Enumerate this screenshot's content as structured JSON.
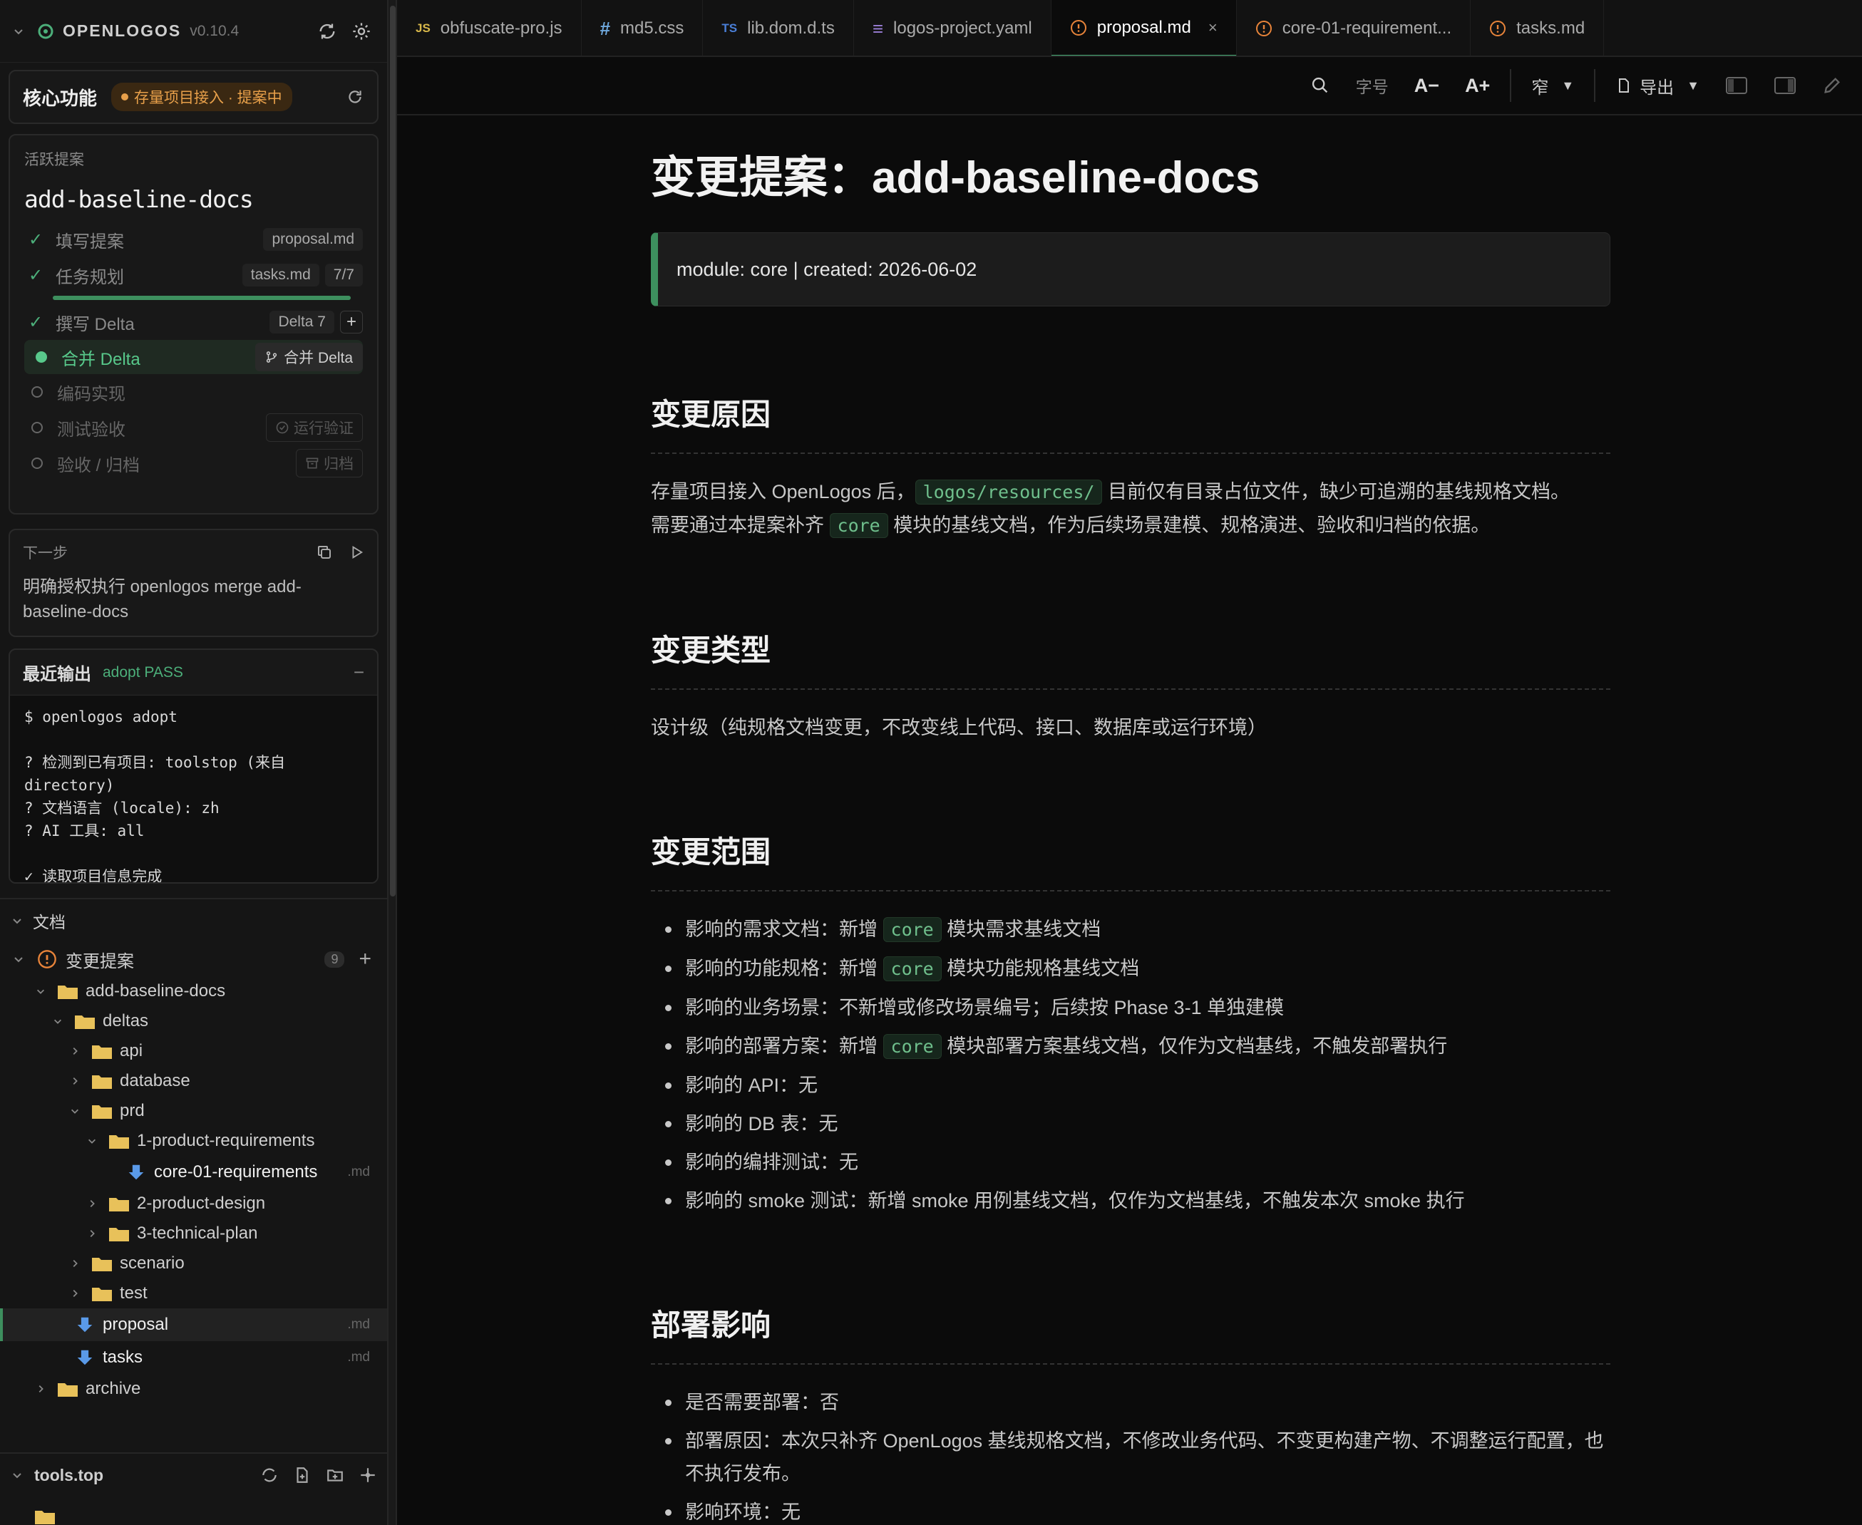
{
  "app": {
    "name": "OPENLOGOS",
    "version": "v0.10.4"
  },
  "core": {
    "title": "核心功能",
    "badge": "存量项目接入 · 提案中"
  },
  "proposal": {
    "section_label": "活跃提案",
    "name": "add-baseline-docs",
    "steps": [
      {
        "label": "填写提案",
        "pill": "proposal.md",
        "done": true
      },
      {
        "label": "任务规划",
        "pill": "tasks.md",
        "pill2": "7/7",
        "done": true
      },
      {
        "label": "撰写 Delta",
        "pill": "Delta 7",
        "done": true
      },
      {
        "label": "合并 Delta",
        "action": "合并 Delta",
        "active": true
      },
      {
        "label": "编码实现"
      },
      {
        "label": "测试验收",
        "action": "运行验证"
      },
      {
        "label": "验收 / 归档",
        "action": "归档"
      }
    ],
    "task_progress": 1.0
  },
  "next": {
    "label": "下一步",
    "text": "明确授权执行 openlogos merge add-baseline-docs"
  },
  "output": {
    "title": "最近输出",
    "status": "adopt PASS",
    "lines": "$ openlogos adopt\n\n? 检测到已有项目: toolstop (来自 directory)\n? 文档语言 (locale): zh\n? AI 工具: all\n\n✓ 读取项目信息完成"
  },
  "docs": {
    "section": "文档",
    "group": "变更提案",
    "group_count": "9",
    "tree": [
      {
        "name": "add-baseline-docs",
        "depth": 1,
        "type": "folder",
        "open": true
      },
      {
        "name": "deltas",
        "depth": 2,
        "type": "folder",
        "open": true
      },
      {
        "name": "api",
        "depth": 3,
        "type": "folder"
      },
      {
        "name": "database",
        "depth": 3,
        "type": "folder"
      },
      {
        "name": "prd",
        "depth": 3,
        "type": "folder",
        "open": true
      },
      {
        "name": "1-product-requirements",
        "depth": 4,
        "type": "folder",
        "open": true
      },
      {
        "name": "core-01-requirements",
        "depth": 5,
        "type": "file",
        "ext": ".md"
      },
      {
        "name": "2-product-design",
        "depth": 4,
        "type": "folder"
      },
      {
        "name": "3-technical-plan",
        "depth": 4,
        "type": "folder"
      },
      {
        "name": "scenario",
        "depth": 3,
        "type": "folder"
      },
      {
        "name": "test",
        "depth": 3,
        "type": "folder"
      },
      {
        "name": "proposal",
        "depth": 2,
        "type": "file",
        "ext": ".md",
        "selected": true
      },
      {
        "name": "tasks",
        "depth": 2,
        "type": "file",
        "ext": ".md"
      },
      {
        "name": "archive",
        "depth": 1,
        "type": "folder"
      }
    ]
  },
  "workspace": {
    "name": "tools.top"
  },
  "tabs": [
    {
      "label": "obfuscate-pro.js",
      "icon": "JS",
      "color": "#d8b84a"
    },
    {
      "label": "md5.css",
      "icon": "#",
      "color": "#6fa8dc"
    },
    {
      "label": "lib.dom.d.ts",
      "icon": "TS",
      "color": "#4a7fd8"
    },
    {
      "label": "logos-project.yaml",
      "icon": "≡",
      "color": "#9b7fd8"
    },
    {
      "label": "proposal.md",
      "icon": "!",
      "color": "#e8843a",
      "active": true
    },
    {
      "label": "core-01-requirement...",
      "icon": "!",
      "color": "#e8843a"
    },
    {
      "label": "tasks.md",
      "icon": "!",
      "color": "#e8843a"
    }
  ],
  "toolbar": {
    "font_label": "字号",
    "dec": "A−",
    "inc": "A+",
    "width": "窄",
    "export": "导出"
  },
  "doc": {
    "title": "变更提案：add-baseline-docs",
    "meta": "module: core | created: 2026-06-02",
    "s1": {
      "h": "变更原因",
      "p1a": "存量项目接入 OpenLogos 后，",
      "c1": "logos/resources/",
      "p1b": " 目前仅有目录占位文件，缺少可追溯的基线规格文档。",
      "p2a": "需要通过本提案补齐 ",
      "c2": "core",
      "p2b": " 模块的基线文档，作为后续场景建模、规格演进、验收和归档的依据。"
    },
    "s2": {
      "h": "变更类型",
      "p": "设计级（纯规格文档变更，不改变线上代码、接口、数据库或运行环境）"
    },
    "s3": {
      "h": "变更范围",
      "items": [
        {
          "a": "影响的需求文档：新增 ",
          "code": "core",
          "b": " 模块需求基线文档"
        },
        {
          "a": "影响的功能规格：新增 ",
          "code": "core",
          "b": " 模块功能规格基线文档"
        },
        {
          "a": "影响的业务场景：不新增或修改场景编号；后续按 Phase 3-1 单独建模"
        },
        {
          "a": "影响的部署方案：新增 ",
          "code": "core",
          "b": " 模块部署方案基线文档，仅作为文档基线，不触发部署执行"
        },
        {
          "a": "影响的 API：无"
        },
        {
          "a": "影响的 DB 表：无"
        },
        {
          "a": "影响的编排测试：无"
        },
        {
          "a": "影响的 smoke 测试：新增 smoke 用例基线文档，仅作为文档基线，不触发本次 smoke 执行"
        }
      ]
    },
    "s4": {
      "h": "部署影响",
      "items": [
        {
          "a": "是否需要部署：否"
        },
        {
          "a": "部署原因：本次只补齐 OpenLogos 基线规格文档，不修改业务代码、不变更构建产物、不调整运行配置，也不执行发布。"
        },
        {
          "a": "影响环境：无"
        }
      ]
    }
  }
}
